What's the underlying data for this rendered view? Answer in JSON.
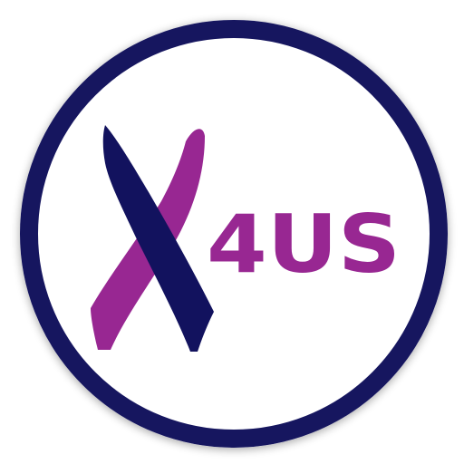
{
  "logo": {
    "wordmark": "4US",
    "colors": {
      "ring": "#12125e",
      "purple": "#982792",
      "navy": "#12125e",
      "background": "#ffffff"
    },
    "icon": "awareness-ribbon-x-icon"
  }
}
